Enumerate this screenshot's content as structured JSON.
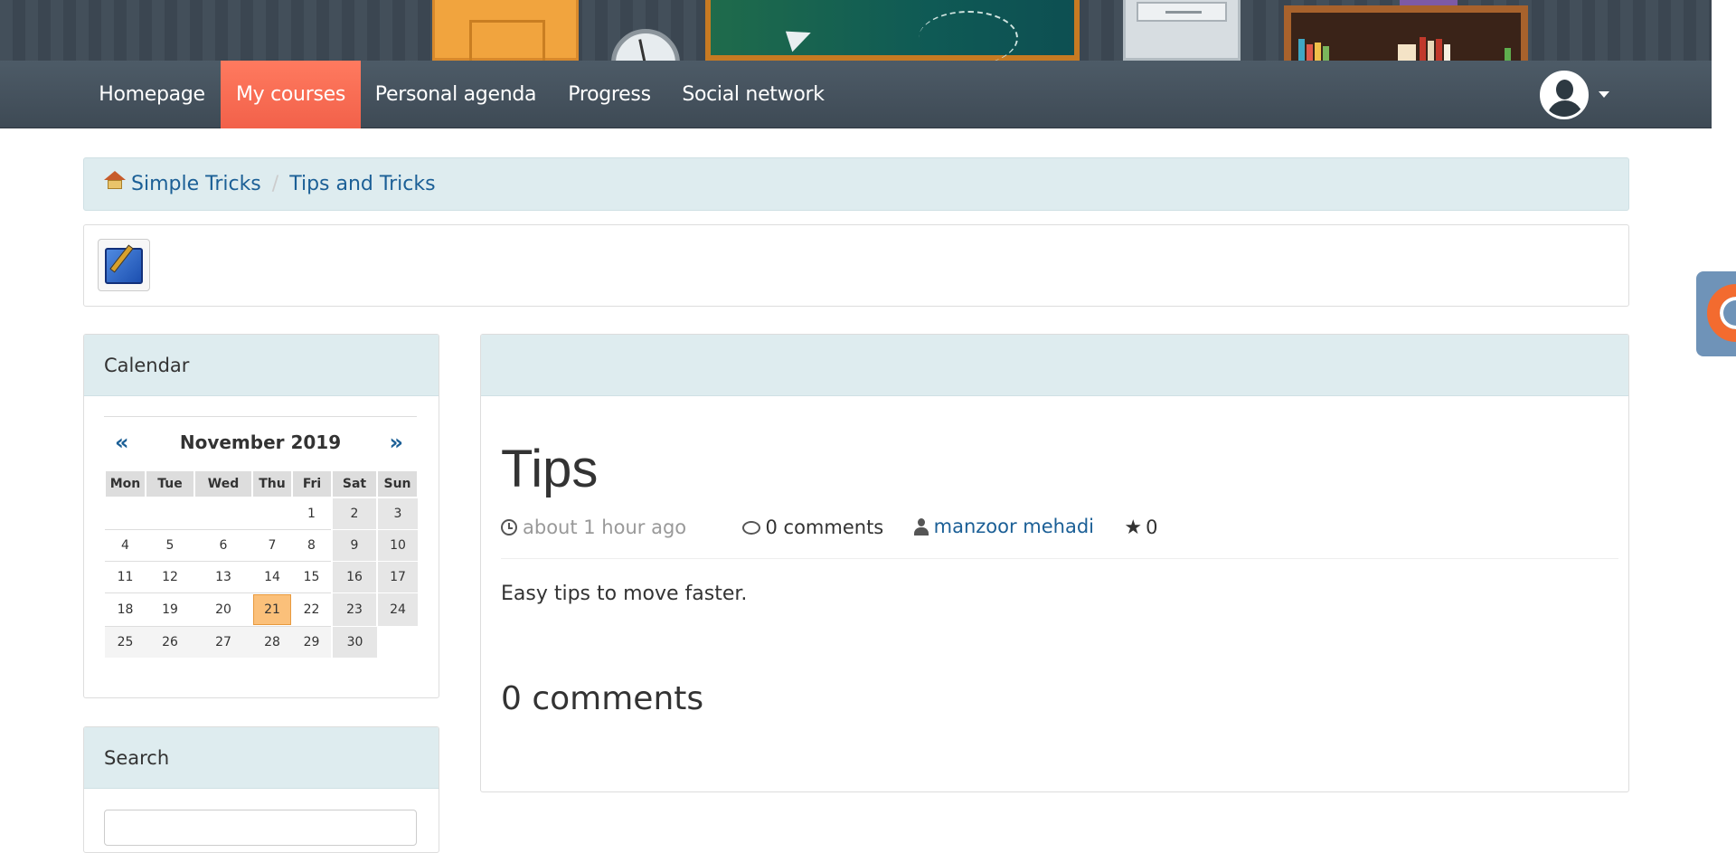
{
  "nav": {
    "items": [
      "Homepage",
      "My courses",
      "Personal agenda",
      "Progress",
      "Social network"
    ],
    "active": "My courses"
  },
  "breadcrumb": {
    "items": [
      "Simple Tricks",
      "Tips and Tricks"
    ]
  },
  "calendar": {
    "heading": "Calendar",
    "prev": "«",
    "next": "»",
    "month_title": "November 2019",
    "weekdays": [
      "Mon",
      "Tue",
      "Wed",
      "Thu",
      "Fri",
      "Sat",
      "Sun"
    ],
    "weeks": [
      [
        "",
        "",
        "",
        "",
        "1",
        "2",
        "3"
      ],
      [
        "4",
        "5",
        "6",
        "7",
        "8",
        "9",
        "10"
      ],
      [
        "11",
        "12",
        "13",
        "14",
        "15",
        "16",
        "17"
      ],
      [
        "18",
        "19",
        "20",
        "21",
        "22",
        "23",
        "24"
      ],
      [
        "25",
        "26",
        "27",
        "28",
        "29",
        "30",
        ""
      ]
    ],
    "today": "21"
  },
  "search": {
    "heading": "Search"
  },
  "post": {
    "title": "Tips",
    "time_ago": "about 1 hour ago",
    "comments_count": "0 comments",
    "author": "manzoor mehadi",
    "rating": "0",
    "body": "Easy tips to move faster.",
    "comments_heading": "0 comments"
  },
  "colors": {
    "navbar": "#434f5a",
    "active_tab": "#f26a4f",
    "panel_head": "#deecef",
    "link": "#1b5f96",
    "today": "#fbc07a"
  }
}
